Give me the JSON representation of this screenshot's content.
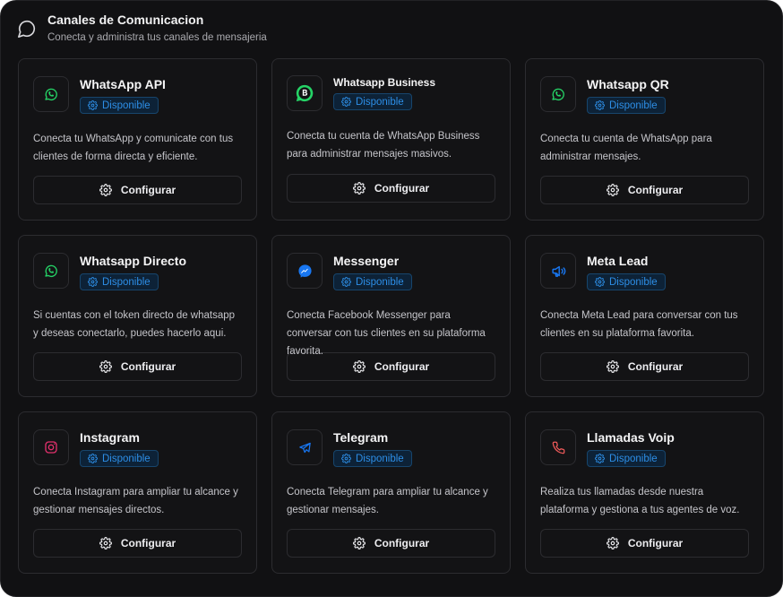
{
  "header": {
    "title": "Canales de Comunicacion",
    "subtitle": "Conecta y administra tus canales de mensajeria",
    "icon": "chat-bubble-icon"
  },
  "colors": {
    "whatsapp": "#25d366",
    "blue": "#1877f2",
    "instagram": "#e1306c",
    "voip": "#f05a5a",
    "badge_text": "#2d8ee6"
  },
  "channels": [
    {
      "title": "WhatsApp API",
      "badge": "Disponible",
      "desc": "Conecta tu WhatsApp y comunicate con tus clientes de forma directa y eficiente.",
      "button": "Configurar",
      "icon": "whatsapp-icon"
    },
    {
      "title": "Whatsapp Business",
      "badge": "Disponible",
      "desc": "Conecta tu cuenta de WhatsApp Business para administrar mensajes masivos.",
      "button": "Configurar",
      "icon": "whatsapp-business-icon"
    },
    {
      "title": "Whatsapp QR",
      "badge": "Disponible",
      "desc": "Conecta tu cuenta de WhatsApp para administrar mensajes.",
      "button": "Configurar",
      "icon": "whatsapp-icon"
    },
    {
      "title": "Whatsapp Directo",
      "badge": "Disponible",
      "desc": "Si cuentas con el token directo de whatsapp y deseas conectarlo, puedes hacerlo aqui.",
      "button": "Configurar",
      "icon": "whatsapp-icon"
    },
    {
      "title": "Messenger",
      "badge": "Disponible",
      "desc": "Conecta Facebook Messenger para conversar con tus clientes en su plataforma favorita.",
      "button": "Configurar",
      "icon": "messenger-icon"
    },
    {
      "title": "Meta Lead",
      "badge": "Disponible",
      "desc": "Conecta Meta Lead para conversar con tus clientes en su plataforma favorita.",
      "button": "Configurar",
      "icon": "megaphone-icon"
    },
    {
      "title": "Instagram",
      "badge": "Disponible",
      "desc": "Conecta Instagram para ampliar tu alcance y gestionar mensajes directos.",
      "button": "Configurar",
      "icon": "instagram-icon"
    },
    {
      "title": "Telegram",
      "badge": "Disponible",
      "desc": "Conecta Telegram para ampliar tu alcance y gestionar mensajes.",
      "button": "Configurar",
      "icon": "telegram-icon"
    },
    {
      "title": "Llamadas Voip",
      "badge": "Disponible",
      "desc": "Realiza tus llamadas desde nuestra plataforma y gestiona a tus agentes de voz.",
      "button": "Configurar",
      "icon": "phone-icon"
    }
  ]
}
